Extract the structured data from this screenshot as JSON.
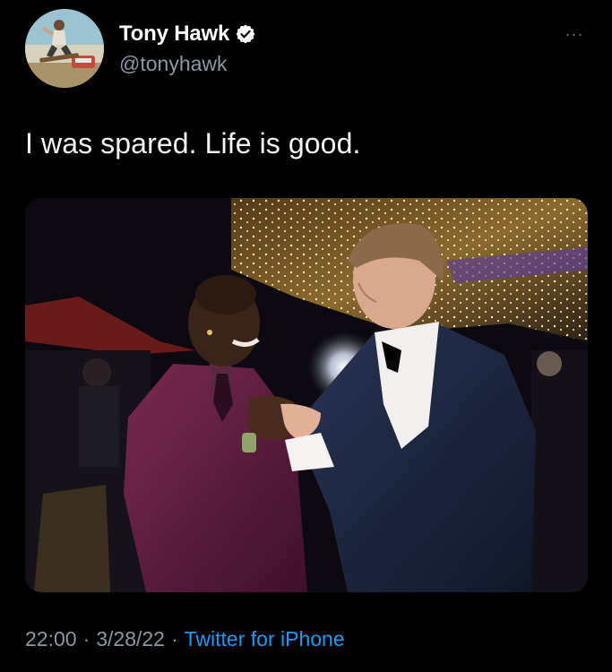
{
  "author": {
    "display_name": "Tony Hawk",
    "handle": "@tonyhawk",
    "verified": true,
    "avatar_icon": "skateboarder-avatar",
    "verified_icon": "verified-badge-icon"
  },
  "more_menu": {
    "label": "···",
    "icon": "more-options-icon"
  },
  "tweet": {
    "text": "I was spared. Life is good."
  },
  "media": {
    "type": "photo",
    "description_icon": "photo-two-men-handshake"
  },
  "meta": {
    "time": "22:00",
    "separator": "·",
    "date": "3/28/22",
    "source": "Twitter for iPhone"
  },
  "colors": {
    "background": "#000000",
    "text_primary": "#ffffff",
    "text_secondary": "#8b98a5",
    "link": "#1d9bf0",
    "verified_badge": "#ffffff"
  }
}
